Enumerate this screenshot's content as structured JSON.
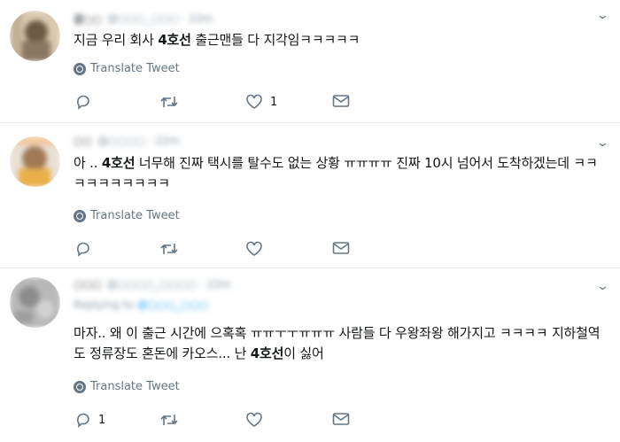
{
  "ui": {
    "translate_label": "Translate Tweet",
    "accent_color": "#1da1f2",
    "muted_color": "#657786"
  },
  "tweets": [
    {
      "name": "강○○",
      "handle": "@○○○_○○○ · 22m",
      "text_pre": "지금 우리 회사 ",
      "text_bold": "4호선",
      "text_post": " 출근맨들 다 지각임ㅋㅋㅋㅋㅋ",
      "reply_count": "",
      "retweet_count": "",
      "like_count": "1"
    },
    {
      "name": "○○",
      "handle": "@○○○○ · 22m",
      "text_pre": "아 .. ",
      "text_bold": "4호선",
      "text_post": " 너무해 진짜    택시를 탈수도 없는 상황 ㅠㅠㅠㅠ  진짜 10시 넘어서  도착하겠는데 ㅋㅋㅋㅋㅋㅋㅋㅋㅋㅋ",
      "reply_count": "",
      "retweet_count": "",
      "like_count": ""
    },
    {
      "name": "○○○",
      "handle": "@○○○○_○○○○ · 22m",
      "replying_label": "Replying to",
      "replying_to": "@○○○_○○○",
      "text_pre": "마자.. 왜 이 출근 시간에 으혹혹 ㅠㅠㅜㅜㅠㅠㅠ 사람들 다 우왕좌왕 해가지고 ㅋㅋㅋㅋ 지하철역도 정류장도 혼돈에 카오스... 난 ",
      "text_bold": "4호선",
      "text_post": "이 싫어",
      "reply_count": "1",
      "retweet_count": "",
      "like_count": ""
    }
  ]
}
